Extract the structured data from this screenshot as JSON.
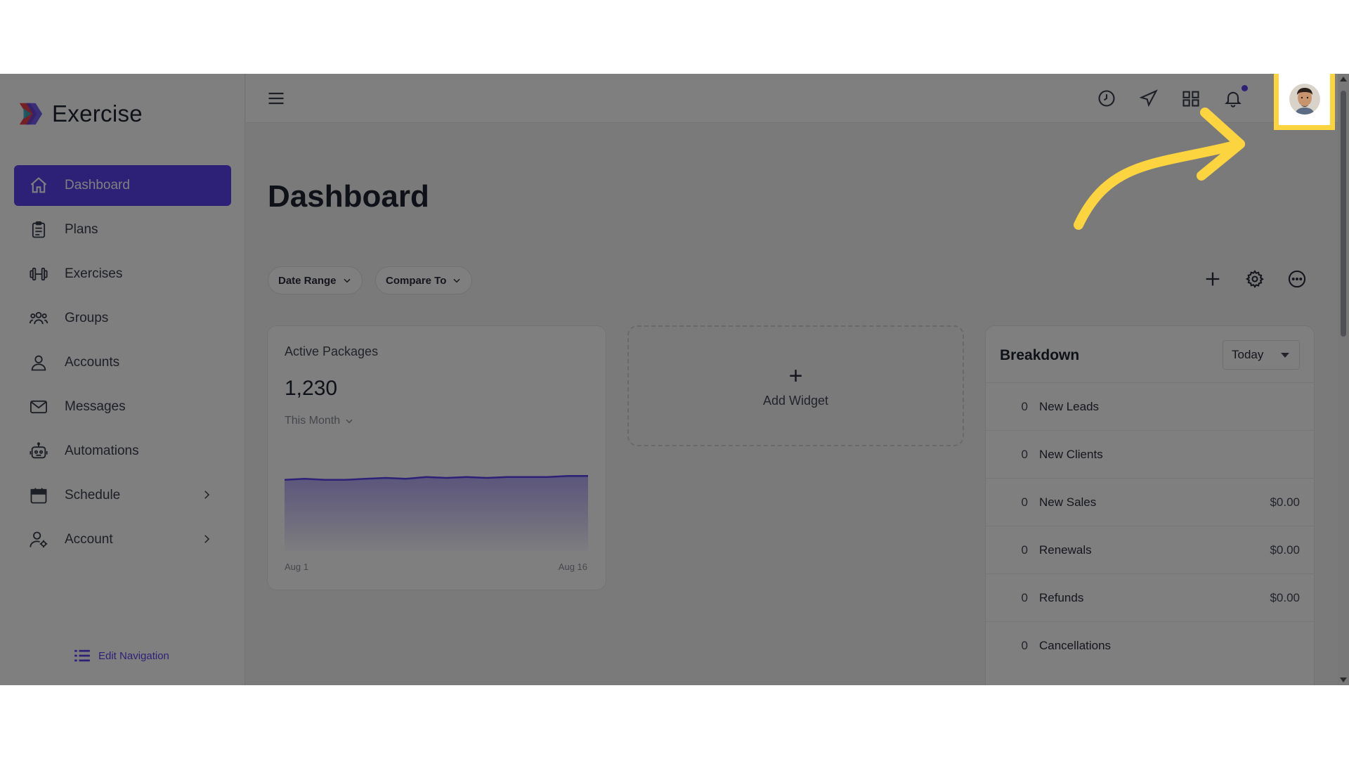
{
  "brand": {
    "name": "Exercise"
  },
  "sidebar": {
    "items": [
      {
        "label": "Dashboard",
        "icon": "home-icon",
        "active": true
      },
      {
        "label": "Plans",
        "icon": "clipboard-icon"
      },
      {
        "label": "Exercises",
        "icon": "dumbbell-icon"
      },
      {
        "label": "Groups",
        "icon": "users-icon"
      },
      {
        "label": "Accounts",
        "icon": "user-icon"
      },
      {
        "label": "Messages",
        "icon": "mail-icon"
      },
      {
        "label": "Automations",
        "icon": "robot-icon"
      },
      {
        "label": "Schedule",
        "icon": "calendar-icon",
        "expandable": true
      },
      {
        "label": "Account",
        "icon": "user-gear-icon",
        "expandable": true
      }
    ],
    "edit_navigation": "Edit Navigation"
  },
  "topbar": {
    "icons": [
      "menu-icon",
      "history-icon",
      "send-icon",
      "grid-icon",
      "bell-icon"
    ],
    "notification_dot_color": "#5b43ee"
  },
  "page": {
    "title": "Dashboard"
  },
  "filters": {
    "date_range": "Date Range",
    "compare_to": "Compare To"
  },
  "actions": [
    "plus-icon",
    "gear-icon",
    "more-icon"
  ],
  "active_packages": {
    "title": "Active Packages",
    "value": "1,230",
    "period": "This Month",
    "x_start": "Aug 1",
    "x_end": "Aug 16"
  },
  "chart_data": {
    "type": "area",
    "x": [
      "Aug 1",
      "Aug 2",
      "Aug 3",
      "Aug 4",
      "Aug 5",
      "Aug 6",
      "Aug 7",
      "Aug 8",
      "Aug 9",
      "Aug 10",
      "Aug 11",
      "Aug 12",
      "Aug 13",
      "Aug 14",
      "Aug 15",
      "Aug 16"
    ],
    "values": [
      1226,
      1227,
      1226,
      1226,
      1227,
      1228,
      1227,
      1229,
      1228,
      1229,
      1228,
      1229,
      1229,
      1229,
      1230,
      1230
    ],
    "ylim": [
      1150,
      1240
    ],
    "color": "#5b43ee"
  },
  "add_widget": {
    "label": "Add Widget"
  },
  "breakdown": {
    "title": "Breakdown",
    "period": "Today",
    "rows": [
      {
        "count": "0",
        "label": "New Leads",
        "amount": ""
      },
      {
        "count": "0",
        "label": "New Clients",
        "amount": ""
      },
      {
        "count": "0",
        "label": "New Sales",
        "amount": "$0.00"
      },
      {
        "count": "0",
        "label": "Renewals",
        "amount": "$0.00"
      },
      {
        "count": "0",
        "label": "Refunds",
        "amount": "$0.00"
      },
      {
        "count": "0",
        "label": "Cancellations",
        "amount": ""
      }
    ]
  },
  "colors": {
    "accent": "#5b43ee",
    "highlight": "#fcd440"
  }
}
